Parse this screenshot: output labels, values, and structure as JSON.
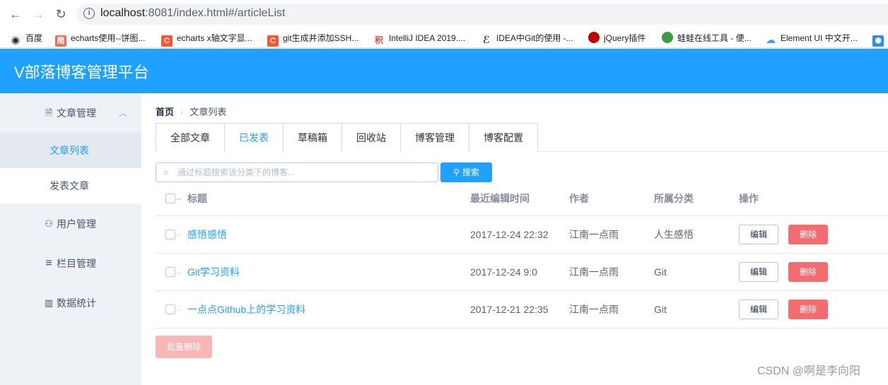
{
  "browser": {
    "url_host": "localhost",
    "url_rest": ":8081/index.html#/articleList",
    "bookmarks": [
      {
        "label": "百度",
        "icon": "globe-icon",
        "color": "#202124",
        "glyph": "◉"
      },
      {
        "label": "echarts使用--饼图...",
        "icon": "jianshu-icon",
        "color": "#ea6f5a",
        "glyph": "简"
      },
      {
        "label": "echarts x轴文字显...",
        "icon": "csdn-icon",
        "color": "#fc5531",
        "glyph": "C"
      },
      {
        "label": "git生成并添加SSH...",
        "icon": "csdn-icon",
        "color": "#fc5531",
        "glyph": "C"
      },
      {
        "label": "IntelliJ IDEA 2019....",
        "icon": "ji-icon",
        "color": "#ffffff",
        "glyph": "积"
      },
      {
        "label": "IDEA中Git的使用 -...",
        "icon": "cnblogs-icon",
        "color": "#ffffff",
        "glyph": "ℰ"
      },
      {
        "label": "jQuery插件",
        "icon": "jquery-icon",
        "color": "#c00000",
        "glyph": "●"
      },
      {
        "label": "蛙蛙在线工具 - 便...",
        "icon": "frog-icon",
        "color": "#3d9a3d",
        "glyph": "●"
      },
      {
        "label": "Element UI 中文开...",
        "icon": "element-icon",
        "color": "#ffffff",
        "glyph": "☁"
      }
    ]
  },
  "header": {
    "title": "V部落博客管理平台"
  },
  "sidebar": {
    "groups": [
      {
        "label": "文章管理",
        "icon": "document-icon",
        "glyph": "🗎"
      },
      {
        "label": "用户管理",
        "icon": "user-icon",
        "glyph": "⚇"
      },
      {
        "label": "栏目管理",
        "icon": "menu-icon",
        "glyph": "≡"
      },
      {
        "label": "数据统计",
        "icon": "chart-icon",
        "glyph": "▥"
      }
    ],
    "subitems": [
      {
        "label": "文章列表",
        "active": true
      },
      {
        "label": "发表文章",
        "active": false
      }
    ]
  },
  "breadcrumb": {
    "home": "首页",
    "current": "文章列表"
  },
  "tabs": [
    {
      "label": "全部文章"
    },
    {
      "label": "已发表"
    },
    {
      "label": "草稿箱"
    },
    {
      "label": "回收站"
    },
    {
      "label": "博客管理"
    },
    {
      "label": "博客配置"
    }
  ],
  "active_tab": "已发表",
  "search": {
    "placeholder": "通过标题搜索该分类下的博客...",
    "button_label": "搜索"
  },
  "table": {
    "columns": [
      "标题",
      "最近编辑时间",
      "作者",
      "所属分类",
      "操作"
    ],
    "rows": [
      {
        "title": "感悟感悟",
        "time": "2017-12-24 22:32",
        "author": "江南一点雨",
        "category": "人生感悟"
      },
      {
        "title": "Git学习资料",
        "time": "2017-12-24 9:0",
        "author": "江南一点雨",
        "category": "Git"
      },
      {
        "title": "一点点Github上的学习资料",
        "time": "2017-12-21 22:35",
        "author": "江南一点雨",
        "category": "Git"
      }
    ],
    "edit_label": "编辑",
    "delete_label": "删除"
  },
  "batch_delete_label": "批量删除",
  "watermark": "CSDN @啊是李向阳"
}
